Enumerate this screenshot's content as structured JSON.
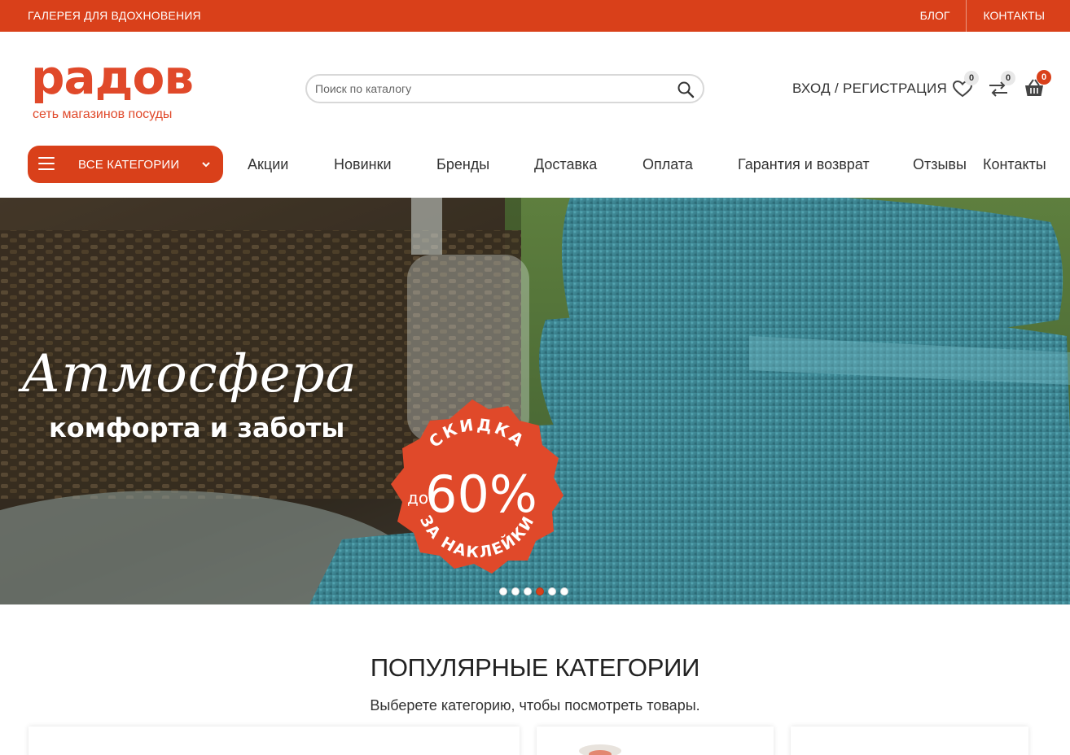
{
  "topbar": {
    "tagline": "ГАЛЕРЕЯ ДЛЯ ВДОХНОВЕНИЯ",
    "blog": "БЛОГ",
    "contacts": "КОНТАКТЫ"
  },
  "header": {
    "logo_word": "радов",
    "logo_sub": "сеть магазинов посуды",
    "search_placeholder": "Поиск по каталогу",
    "login": "ВХОД / РЕГИСТРАЦИЯ",
    "wishlist_count": "0",
    "compare_count": "0",
    "cart_count": "0"
  },
  "nav": {
    "categories_button": "ВСЕ КАТЕГОРИИ",
    "items": [
      "Акции",
      "Новинки",
      "Бренды",
      "Доставка",
      "Оплата",
      "Гарантия и возврат",
      "Отзывы",
      "Контакты"
    ]
  },
  "hero": {
    "title": "Атмосфера",
    "subtitle": "комфорта и заботы",
    "sticker_top": "СКИДКА",
    "sticker_prefix": "до",
    "sticker_value": "60%",
    "sticker_bottom": "ЗА НАКЛЕЙКИ",
    "slides_total": 6,
    "slide_active": 4
  },
  "popular": {
    "title": "ПОПУЛЯРНЫЕ КАТЕГОРИИ",
    "subtitle": "Выберете категорию, чтобы посмотреть товары."
  },
  "colors": {
    "brand": "#d9401a",
    "logo": "#e0492a",
    "towel": "#3f8c99"
  }
}
